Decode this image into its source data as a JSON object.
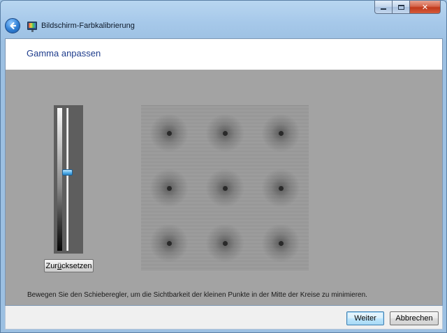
{
  "window": {
    "title": "Bildschirm-Farbkalibrierung",
    "controls": {
      "minimize_icon": "minimize-icon",
      "maximize_icon": "maximize-icon",
      "close_icon": "close-icon",
      "close_glyph": "✕"
    }
  },
  "nav": {
    "back_icon": "back-arrow-icon",
    "app_icon": "display-calibration-icon"
  },
  "page": {
    "title": "Gamma anpassen"
  },
  "gamma_slider": {
    "value_fraction": 0.45
  },
  "reset_button": {
    "label": "Zurücksetzen",
    "mnemonic": "ü"
  },
  "gamma_test_image": {
    "rows": 3,
    "columns": 3
  },
  "instruction": "Bewegen Sie den Schieberegler, um die Sichtbarkeit der kleinen Punkte in der Mitte der Kreise zu minimieren.",
  "footer": {
    "next_label": "Weiter",
    "cancel_label": "Abbrechen"
  },
  "colors": {
    "title_blue": "#1e3c8c",
    "content_gray": "#a3a3a3",
    "slider_thumb": "#57b1ea"
  }
}
